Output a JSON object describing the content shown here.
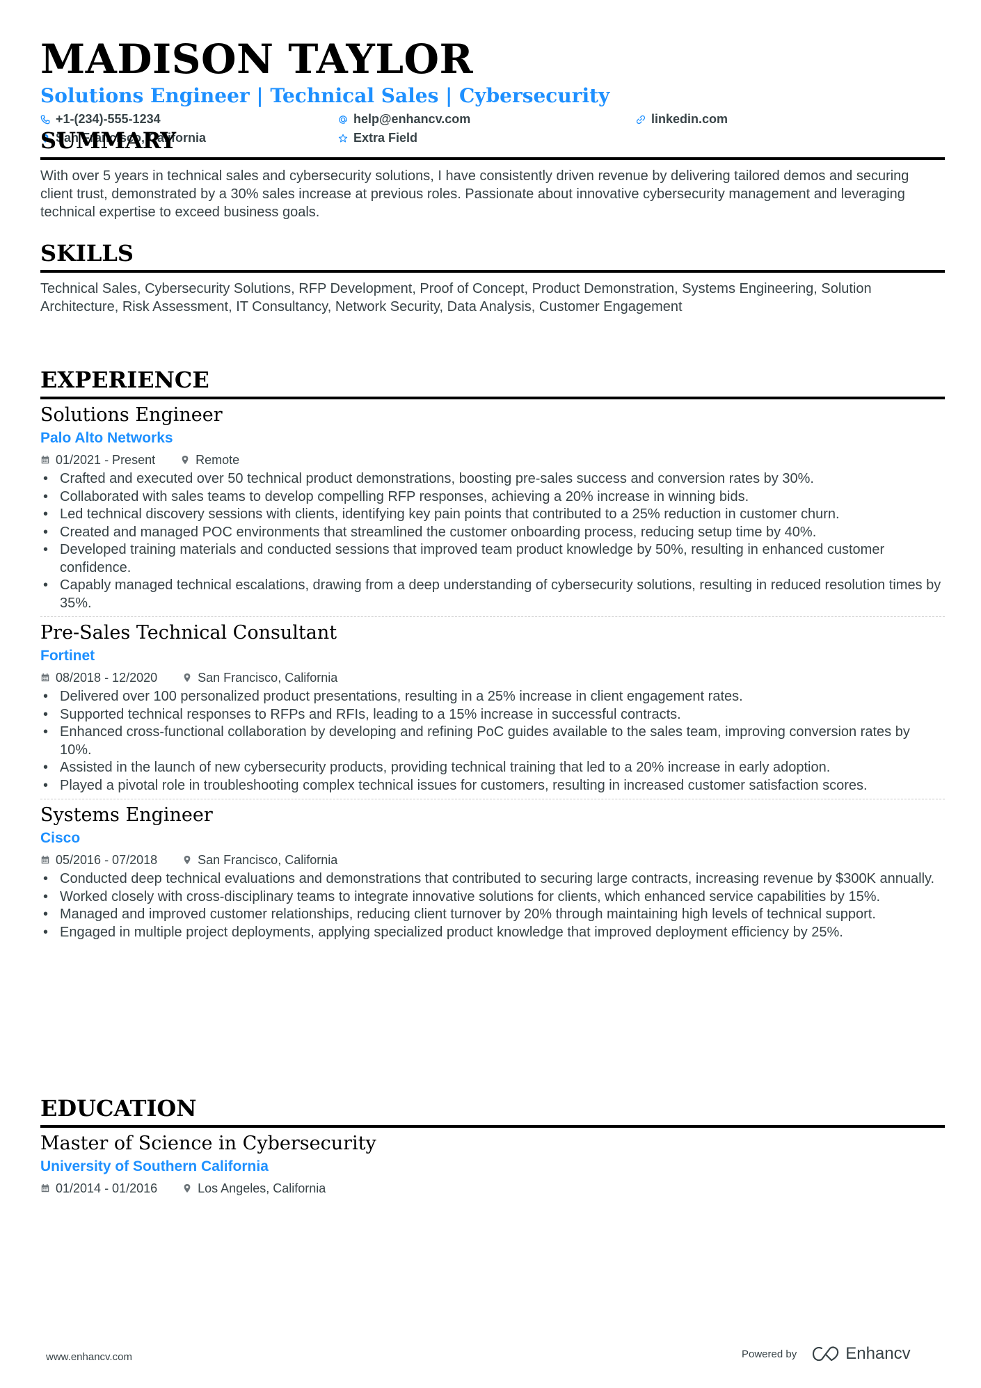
{
  "header": {
    "name": "MADISON TAYLOR",
    "headline": "Solutions Engineer | Technical Sales | Cybersecurity",
    "contacts": [
      {
        "icon": "phone-icon",
        "text": "+1-(234)-555-1234"
      },
      {
        "icon": "at-icon",
        "text": "help@enhancv.com"
      },
      {
        "icon": "link-icon",
        "text": "linkedin.com"
      },
      {
        "icon": "location-pin-icon",
        "text": "San Francisco, California"
      },
      {
        "icon": "star-icon",
        "text": "Extra Field"
      }
    ]
  },
  "colors": {
    "accent": "#1e90ff",
    "text": "#384347",
    "heading": "#000000"
  },
  "summary": {
    "title": "SUMMARY",
    "text": "With over 5 years in technical sales and cybersecurity solutions, I have consistently driven revenue by delivering tailored demos and securing client trust, demonstrated by a 30% sales increase at previous roles. Passionate about innovative cybersecurity management and leveraging technical expertise to exceed business goals."
  },
  "skills": {
    "title": "SKILLS",
    "text": "Technical Sales, Cybersecurity Solutions, RFP Development, Proof of Concept, Product Demonstration, Systems Engineering, Solution Architecture, Risk Assessment, IT Consultancy, Network Security, Data Analysis, Customer Engagement"
  },
  "experience": {
    "title": "EXPERIENCE",
    "jobs": [
      {
        "role": "Solutions Engineer",
        "company": "Palo Alto Networks",
        "dates": "01/2021 - Present",
        "location": "Remote",
        "bullets": [
          "Crafted and executed over 50 technical product demonstrations, boosting pre-sales success and conversion rates by 30%.",
          "Collaborated with sales teams to develop compelling RFP responses, achieving a 20% increase in winning bids.",
          "Led technical discovery sessions with clients, identifying key pain points that contributed to a 25% reduction in customer churn.",
          "Created and managed POC environments that streamlined the customer onboarding process, reducing setup time by 40%.",
          "Developed training materials and conducted sessions that improved team product knowledge by 50%, resulting in enhanced customer confidence.",
          "Capably managed technical escalations, drawing from a deep understanding of cybersecurity solutions, resulting in reduced resolution times by 35%."
        ]
      },
      {
        "role": "Pre-Sales Technical Consultant",
        "company": "Fortinet",
        "dates": "08/2018 - 12/2020",
        "location": "San Francisco, California",
        "bullets": [
          "Delivered over 100 personalized product presentations, resulting in a 25% increase in client engagement rates.",
          "Supported technical responses to RFPs and RFIs, leading to a 15% increase in successful contracts.",
          "Enhanced cross-functional collaboration by developing and refining PoC guides available to the sales team, improving conversion rates by 10%.",
          "Assisted in the launch of new cybersecurity products, providing technical training that led to a 20% increase in early adoption.",
          "Played a pivotal role in troubleshooting complex technical issues for customers, resulting in increased customer satisfaction scores."
        ]
      },
      {
        "role": "Systems Engineer",
        "company": "Cisco",
        "dates": "05/2016 - 07/2018",
        "location": "San Francisco, California",
        "bullets": [
          "Conducted deep technical evaluations and demonstrations that contributed to securing large contracts, increasing revenue by $300K annually.",
          "Worked closely with cross-disciplinary teams to integrate innovative solutions for clients, which enhanced service capabilities by 15%.",
          "Managed and improved customer relationships, reducing client turnover by 20% through maintaining high levels of technical support.",
          "Engaged in multiple project deployments, applying specialized product knowledge that improved deployment efficiency by 25%."
        ]
      }
    ]
  },
  "education": {
    "title": "EDUCATION",
    "items": [
      {
        "degree": "Master of Science in Cybersecurity",
        "school": "University of Southern California",
        "dates": "01/2014 - 01/2016",
        "location": "Los Angeles, California"
      }
    ]
  },
  "footer": {
    "website": "www.enhancv.com",
    "powered_by": "Powered by",
    "brand": "Enhancv"
  }
}
